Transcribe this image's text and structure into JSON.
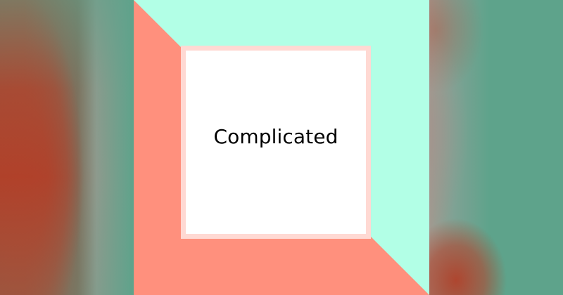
{
  "colors": {
    "background_teal": "#5ea38b",
    "background_red": "#b1412a",
    "mint": "#b2ffe6",
    "salmon": "#ff907d",
    "card_border": "#ffd9d3",
    "card_fill": "#ffffff",
    "text": "#000000"
  },
  "main": {
    "card_text": "Complicated"
  }
}
